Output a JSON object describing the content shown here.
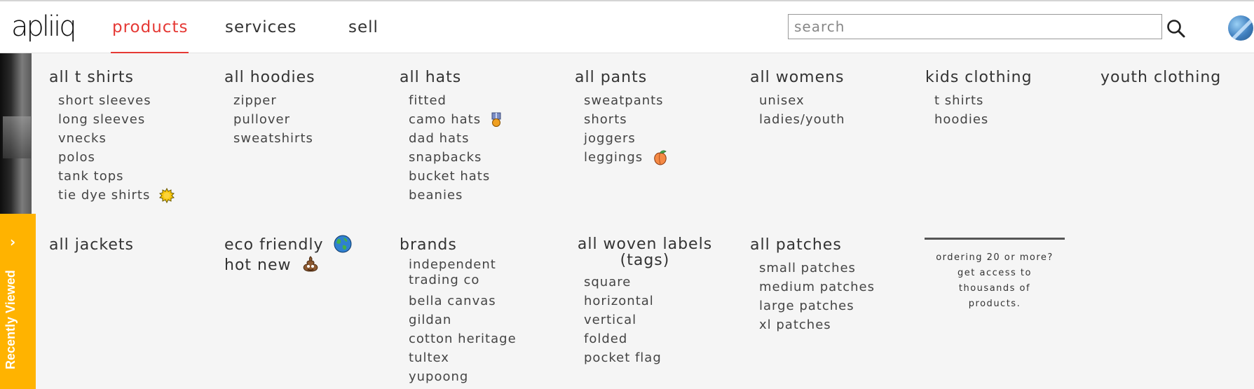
{
  "header": {
    "logo": "apliiq",
    "nav": [
      "products",
      "services",
      "sell"
    ],
    "search_placeholder": "search"
  },
  "sidebar": {
    "recently_viewed": "Recently Viewed"
  },
  "menu": {
    "t_shirts": {
      "title": "all t shirts",
      "items": [
        "short sleeves",
        "long sleeves",
        "vnecks",
        "polos",
        "tank tops",
        "tie dye shirts"
      ]
    },
    "hoodies": {
      "title": "all hoodies",
      "items": [
        "zipper",
        "pullover",
        "sweatshirts"
      ]
    },
    "hats": {
      "title": "all hats",
      "items": [
        "fitted",
        "camo hats",
        "dad hats",
        "snapbacks",
        "bucket hats",
        "beanies"
      ]
    },
    "pants": {
      "title": "all pants",
      "items": [
        "sweatpants",
        "shorts",
        "joggers",
        "leggings"
      ]
    },
    "womens": {
      "title": "all womens",
      "items": [
        "unisex",
        "ladies/youth"
      ]
    },
    "kids": {
      "title": "kids clothing",
      "items": [
        "t shirts",
        "hoodies"
      ]
    },
    "youth": {
      "title": "youth clothing"
    },
    "jackets": {
      "title": "all jackets"
    },
    "eco": {
      "title": "eco friendly"
    },
    "hot": {
      "title": "hot new"
    },
    "brands": {
      "title": "brands",
      "items": [
        "independent",
        "trading co",
        "bella canvas",
        "gildan",
        "cotton heritage",
        "tultex",
        "yupoong"
      ]
    },
    "labels": {
      "title_line1": "all woven labels",
      "title_line2": "(tags)",
      "items": [
        "square",
        "horizontal",
        "vertical",
        "folded",
        "pocket flag"
      ]
    },
    "patches": {
      "title": "all patches",
      "items": [
        "small patches",
        "medium patches",
        "large patches",
        "xl patches"
      ]
    }
  },
  "promo": {
    "text": "ordering 20 or more?\nget access to\nthousands of\nproducts."
  },
  "colors": {
    "accent": "#e53935",
    "recently_viewed_bg": "#ffb300",
    "menu_bg": "#f5f5f5"
  },
  "icons": {
    "tie_dye": "sun-icon",
    "camo_hats": "medal-icon",
    "leggings": "peach-icon",
    "eco_friendly": "globe-icon",
    "hot_new": "poop-icon"
  }
}
